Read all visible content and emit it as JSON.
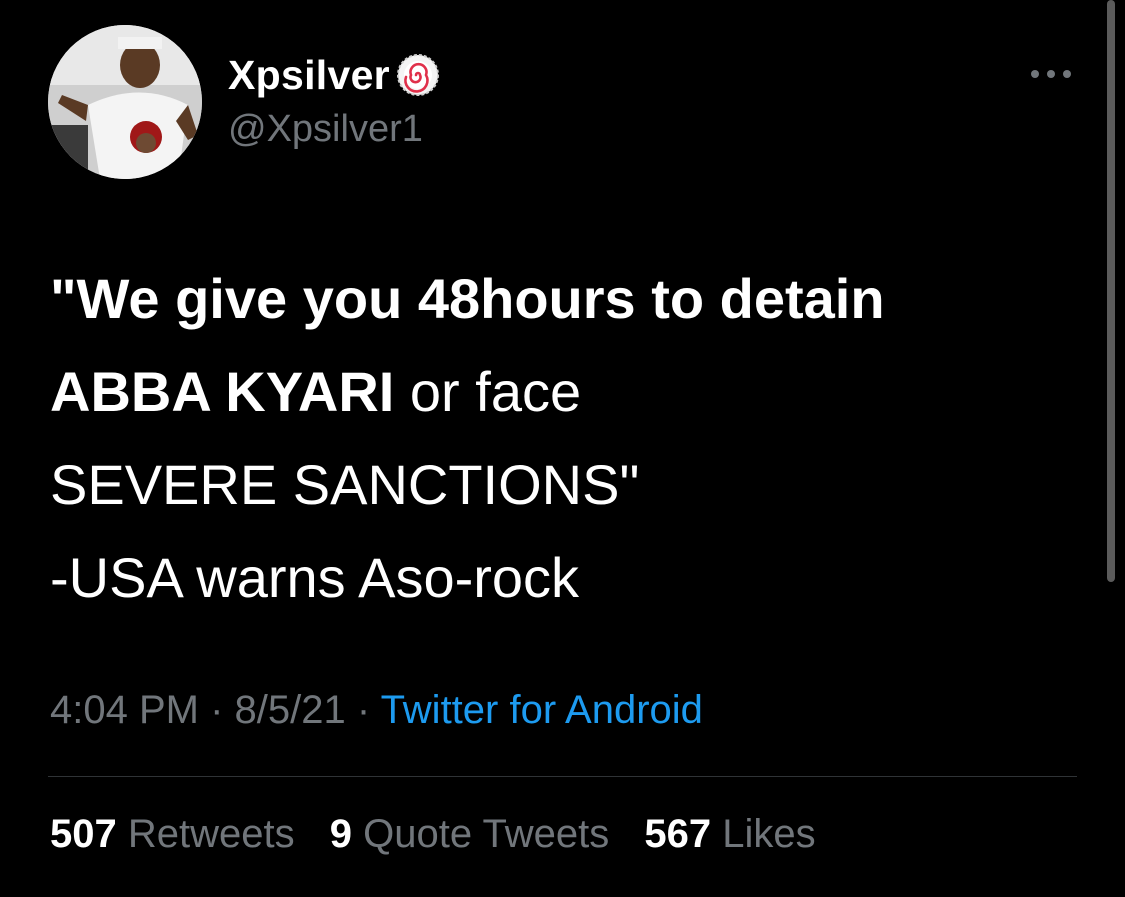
{
  "author": {
    "display_name": "Xpsilver",
    "handle": "@Xpsilver1",
    "badge_icon": "candy-swirl-icon"
  },
  "tweet": {
    "line1": "\"We give you 48hours to detain",
    "line2_bold": "ABBA KYARI",
    "line2_rest": " or face",
    "line3": "SEVERE SANCTIONS\"",
    "line4": "-USA warns Aso-rock"
  },
  "meta": {
    "time": "4:04 PM",
    "sep1": " · ",
    "date": "8/5/21",
    "sep2": " · ",
    "source": "Twitter for Android"
  },
  "stats": {
    "retweets_count": "507",
    "retweets_label": "Retweets",
    "quotes_count": "9",
    "quotes_label": "Quote Tweets",
    "likes_count": "567",
    "likes_label": "Likes"
  },
  "colors": {
    "background": "#000000",
    "text": "#ffffff",
    "secondary": "#71767b",
    "link": "#1d9bf0"
  }
}
